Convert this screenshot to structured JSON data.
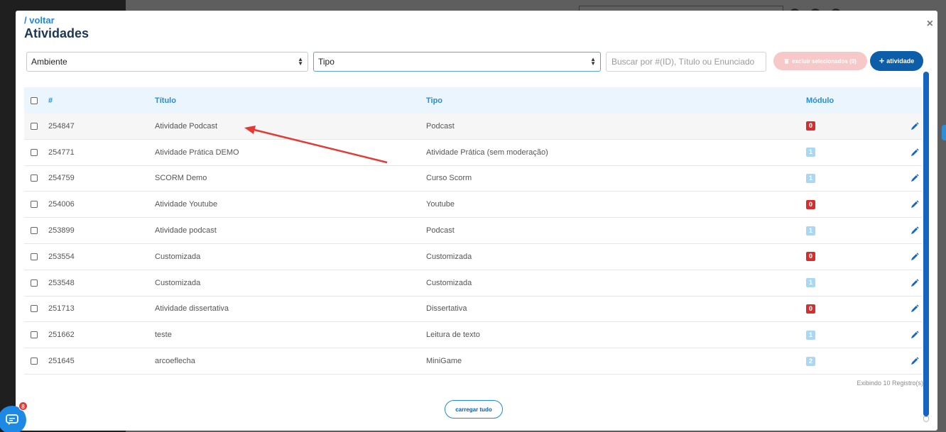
{
  "modal": {
    "back_link": "/ voltar",
    "title": "Atividades",
    "close_glyph": "×"
  },
  "filters": {
    "ambiente": "Ambiente",
    "tipo": "Tipo",
    "search_placeholder": "Buscar por #(ID), Título ou Enunciado",
    "delete_label": "excluir selecionados (0)",
    "add_label": "atividade"
  },
  "table": {
    "headers": {
      "id": "#",
      "title": "Título",
      "tipo": "Tipo",
      "modulo": "Módulo"
    },
    "rows": [
      {
        "id": "254847",
        "title": "Atividade Podcast",
        "tipo": "Podcast",
        "modulo": "0"
      },
      {
        "id": "254771",
        "title": "Atividade Prática DEMO",
        "tipo": "Atividade Prática (sem moderação)",
        "modulo": "1"
      },
      {
        "id": "254759",
        "title": "SCORM Demo",
        "tipo": "Curso Scorm",
        "modulo": "1"
      },
      {
        "id": "254006",
        "title": "Atividade Youtube",
        "tipo": "Youtube",
        "modulo": "0"
      },
      {
        "id": "253899",
        "title": "Atividade podcast",
        "tipo": "Podcast",
        "modulo": "1"
      },
      {
        "id": "253554",
        "title": "Customizada",
        "tipo": "Customizada",
        "modulo": "0"
      },
      {
        "id": "253548",
        "title": "Customizada",
        "tipo": "Customizada",
        "modulo": "1"
      },
      {
        "id": "251713",
        "title": "Atividade dissertativa",
        "tipo": "Dissertativa",
        "modulo": "0"
      },
      {
        "id": "251662",
        "title": "teste",
        "tipo": "Leitura de texto",
        "modulo": "1"
      },
      {
        "id": "251645",
        "title": "arcoeflecha",
        "tipo": "MiniGame",
        "modulo": "2"
      }
    ]
  },
  "footer": {
    "info": "Exibindo 10 Registro(s)",
    "load_all": "carregar tudo"
  },
  "chat": {
    "badge": "8"
  },
  "colors": {
    "badge_zero": "#d32f2f",
    "badge_nonzero": "#a9d8f5",
    "primary": "#0d5ea8",
    "accent": "#1e88e5",
    "annotation_arrow": "#e53935"
  },
  "icons": {
    "edit": "pencil-icon",
    "sort": "sort-arrows-icon",
    "close": "close-icon",
    "chat": "chat-icon",
    "trash": "trash-icon",
    "plus": "plus-icon"
  }
}
